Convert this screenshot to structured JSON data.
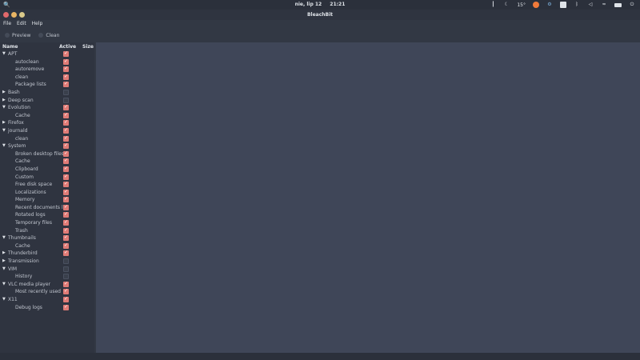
{
  "system_bar": {
    "search_glyph": "🔍",
    "date": "nie, lip 12",
    "time": "21:21",
    "weather": "15°",
    "tray_icons": [
      "notification-icon",
      "moon-icon",
      "update-icon",
      "settings-icon",
      "keyboard-icon",
      "bluetooth-icon",
      "volume-icon",
      "wifi-icon",
      "battery-icon",
      "power-icon"
    ]
  },
  "window": {
    "title": "BleachBit",
    "menu": [
      "File",
      "Edit",
      "Help"
    ],
    "toolbar": {
      "preview": "Preview",
      "clean": "Clean"
    }
  },
  "tree": {
    "headers": {
      "name": "Name",
      "active": "Active",
      "size": "Size"
    },
    "rows": [
      {
        "label": "APT",
        "level": 0,
        "expanded": true,
        "active": true
      },
      {
        "label": "autoclean",
        "level": 1,
        "active": true
      },
      {
        "label": "autoremove",
        "level": 1,
        "active": true
      },
      {
        "label": "clean",
        "level": 1,
        "active": true
      },
      {
        "label": "Package lists",
        "level": 1,
        "active": true
      },
      {
        "label": "Bash",
        "level": 0,
        "expanded": false,
        "active": false
      },
      {
        "label": "Deep scan",
        "level": 0,
        "expanded": false,
        "active": false
      },
      {
        "label": "Evolution",
        "level": 0,
        "expanded": true,
        "active": true
      },
      {
        "label": "Cache",
        "level": 1,
        "active": true
      },
      {
        "label": "Firefox",
        "level": 0,
        "expanded": false,
        "active": true
      },
      {
        "label": "journald",
        "level": 0,
        "expanded": true,
        "active": true
      },
      {
        "label": "clean",
        "level": 1,
        "active": true
      },
      {
        "label": "System",
        "level": 0,
        "expanded": true,
        "active": true
      },
      {
        "label": "Broken desktop files",
        "level": 1,
        "active": true
      },
      {
        "label": "Cache",
        "level": 1,
        "active": true
      },
      {
        "label": "Clipboard",
        "level": 1,
        "active": true
      },
      {
        "label": "Custom",
        "level": 1,
        "active": true
      },
      {
        "label": "Free disk space",
        "level": 1,
        "active": true
      },
      {
        "label": "Localizations",
        "level": 1,
        "active": true
      },
      {
        "label": "Memory",
        "level": 1,
        "active": true
      },
      {
        "label": "Recent documents list",
        "level": 1,
        "active": true
      },
      {
        "label": "Rotated logs",
        "level": 1,
        "active": true
      },
      {
        "label": "Temporary files",
        "level": 1,
        "active": true
      },
      {
        "label": "Trash",
        "level": 1,
        "active": true
      },
      {
        "label": "Thumbnails",
        "level": 0,
        "expanded": true,
        "active": true
      },
      {
        "label": "Cache",
        "level": 1,
        "active": true
      },
      {
        "label": "Thunderbird",
        "level": 0,
        "expanded": false,
        "active": true
      },
      {
        "label": "Transmission",
        "level": 0,
        "expanded": false,
        "active": false
      },
      {
        "label": "VIM",
        "level": 0,
        "expanded": true,
        "active": false
      },
      {
        "label": "History",
        "level": 1,
        "active": false
      },
      {
        "label": "VLC media player",
        "level": 0,
        "expanded": true,
        "active": true
      },
      {
        "label": "Most recently used",
        "level": 1,
        "active": true
      },
      {
        "label": "X11",
        "level": 0,
        "expanded": true,
        "active": true
      },
      {
        "label": "Debug logs",
        "level": 1,
        "active": true
      }
    ]
  },
  "colors": {
    "accent_checkbox": "#e07b76",
    "content_bg": "#3f4658",
    "panel_bg": "#2f3440"
  }
}
